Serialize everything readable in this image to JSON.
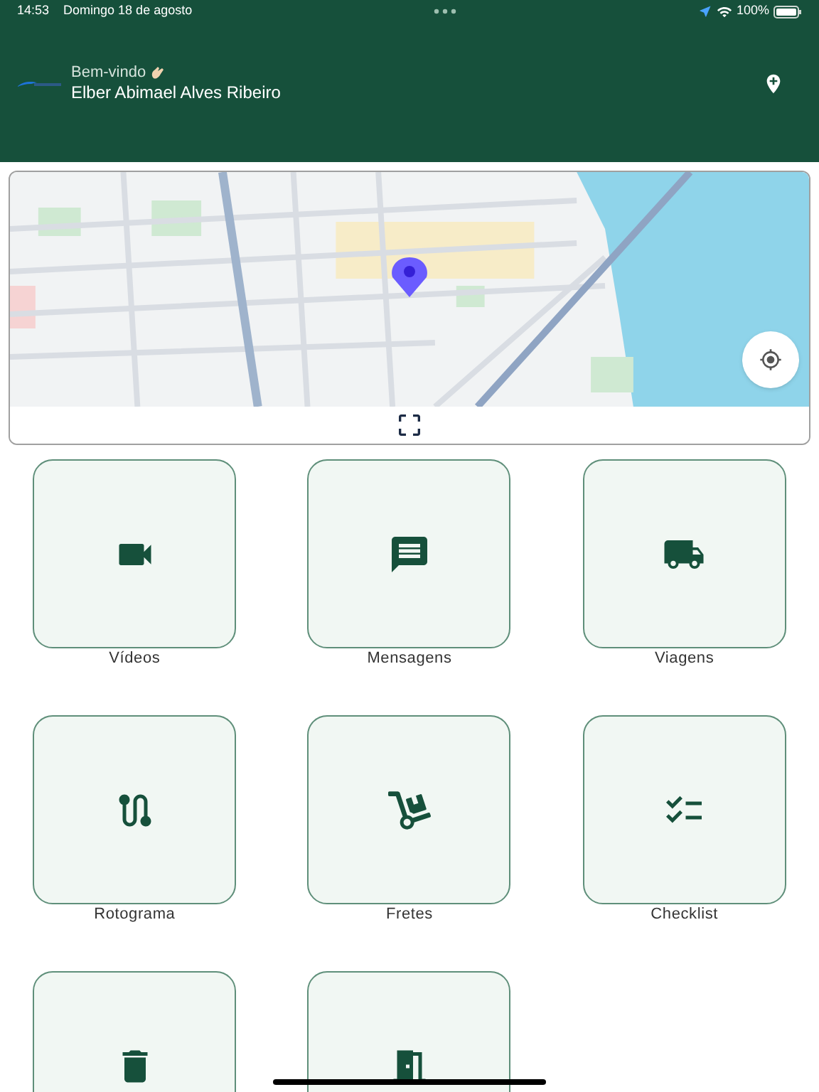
{
  "status_bar": {
    "time": "14:53",
    "date": "Domingo 18 de agosto",
    "battery": "100%"
  },
  "header": {
    "greeting": "Bem-vindo",
    "user_name": "Elber Abimael Alves Ribeiro"
  },
  "menu": [
    {
      "label": "Vídeos"
    },
    {
      "label": "Mensagens"
    },
    {
      "label": "Viagens"
    },
    {
      "label": "Rotograma"
    },
    {
      "label": "Fretes"
    },
    {
      "label": "Checklist"
    }
  ]
}
